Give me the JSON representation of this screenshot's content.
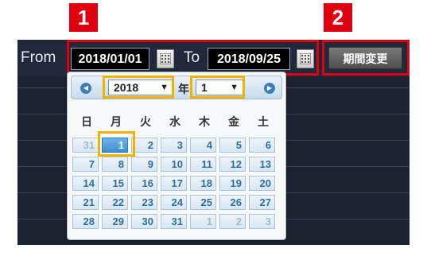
{
  "badges": {
    "one": "1",
    "two": "2"
  },
  "toolbar": {
    "from_label": "From",
    "from_date": "2018/01/01",
    "to_label": "To",
    "to_date": "2018/09/25",
    "change_button": "期間変更"
  },
  "datepicker": {
    "year": "2018",
    "year_suffix": "年",
    "month": "1",
    "weekdays": [
      "日",
      "月",
      "火",
      "水",
      "木",
      "金",
      "土"
    ],
    "weeks": [
      [
        "31",
        "1",
        "2",
        "3",
        "4",
        "5",
        "6"
      ],
      [
        "7",
        "8",
        "9",
        "10",
        "11",
        "12",
        "13"
      ],
      [
        "14",
        "15",
        "16",
        "17",
        "18",
        "19",
        "20"
      ],
      [
        "21",
        "22",
        "23",
        "24",
        "25",
        "26",
        "27"
      ],
      [
        "28",
        "29",
        "30",
        "31",
        "1",
        "2",
        "3"
      ]
    ],
    "other_month_cells": [
      [
        0,
        0
      ],
      [
        4,
        4
      ],
      [
        4,
        5
      ],
      [
        4,
        6
      ]
    ],
    "selected_cell": [
      0,
      1
    ]
  },
  "colors": {
    "highlight_red": "#e1000f",
    "highlight_yellow": "#f2b200",
    "panel_dark": "#1b2230"
  },
  "icons": [
    "calendar-icon",
    "prev-arrow-icon",
    "next-arrow-icon",
    "dropdown-arrow-icon"
  ]
}
